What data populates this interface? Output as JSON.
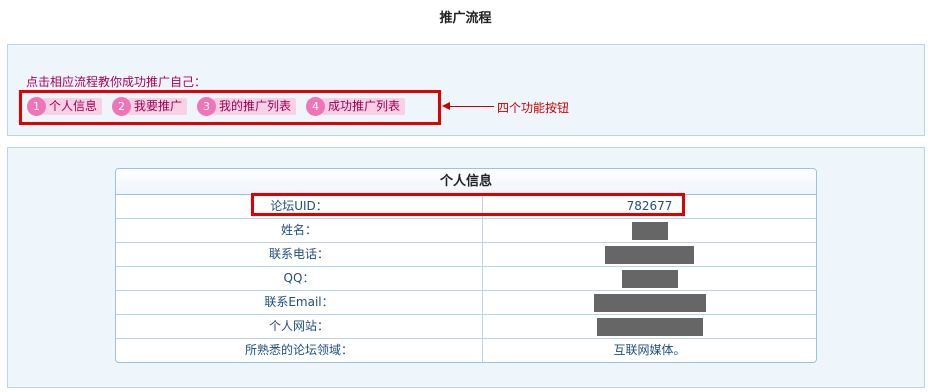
{
  "page_title": "推广流程",
  "intro": "点击相应流程教你成功推广自己：",
  "steps": [
    {
      "num": "1",
      "label": "个人信息"
    },
    {
      "num": "2",
      "label": "我要推广"
    },
    {
      "num": "3",
      "label": "我的推广列表"
    },
    {
      "num": "4",
      "label": "成功推广列表"
    }
  ],
  "annotation": "四个功能按钮",
  "info": {
    "title": "个人信息",
    "rows": [
      {
        "label": "论坛UID：",
        "value": "782677"
      },
      {
        "label": "姓名：",
        "value": ""
      },
      {
        "label": "联系电话：",
        "value": ""
      },
      {
        "label": "QQ：",
        "value": ""
      },
      {
        "label": "联系Email：",
        "value": ""
      },
      {
        "label": "个人网站：",
        "value": ""
      },
      {
        "label": "所熟悉的论坛领域：",
        "value": "互联网媒体。"
      }
    ]
  },
  "colors": {
    "accent_pink": "#f074b8",
    "annotation_red": "#e00000",
    "panel_bg": "#eef6fc"
  }
}
